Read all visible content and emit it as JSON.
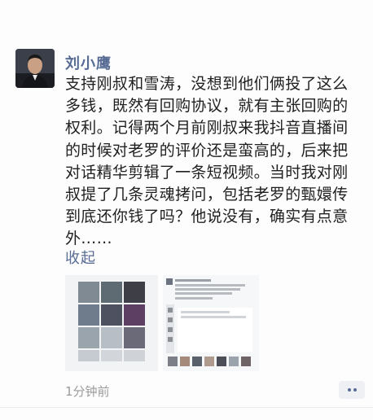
{
  "post": {
    "author": "刘小鹰",
    "text_lines": [
      "支持刚叔和雪涛，没想到他们俩投了这么",
      "多钱，既然有回购协议，就有主张回购的",
      "权利。记得两个月前刚叔来我抖音直播间",
      "的时候对老罗的评价还是蛮高的，后来把",
      "对话精华剪辑了一条短视频。当时我对刚",
      "叔提了几条灵魂拷问，包括老罗的甄嬛传",
      "到底还你钱了吗？他说没有，确实有点意",
      "外……"
    ],
    "collapse_label": "收起",
    "time": "1分钟前",
    "images": [
      {
        "icon": "photo-grid-thumbnail"
      },
      {
        "icon": "chat-screenshot-thumbnail"
      }
    ]
  },
  "colors": {
    "link": "#576b95",
    "text": "#1f1f1f",
    "time": "#9b9b9b"
  }
}
